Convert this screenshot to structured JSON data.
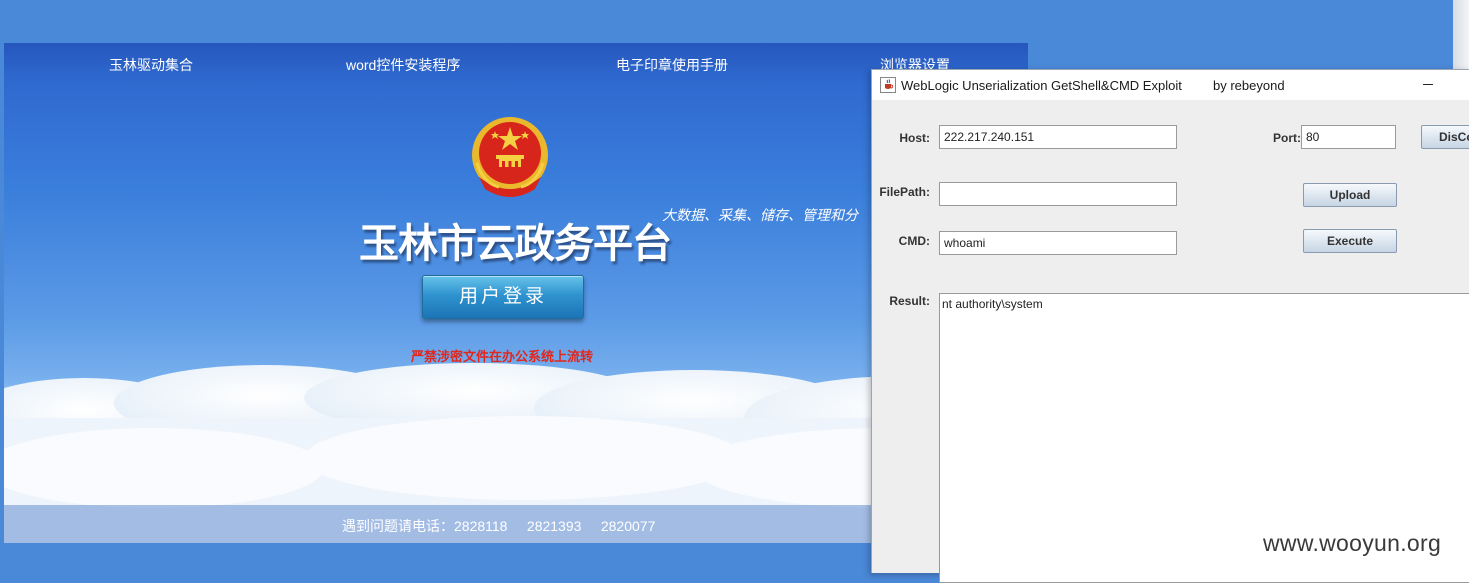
{
  "webpage": {
    "nav": [
      "玉林驱动集合",
      "word控件安装程序",
      "电子印章使用手册",
      "浏览器设置"
    ],
    "title": "玉林市云政务平台",
    "slogan": "大数据、采集、储存、管理和分",
    "login_button": "用户登录",
    "warning": "严禁涉密文件在办公系统上流转",
    "footer": "遇到问题请电话：2828118     2821393     2820077"
  },
  "exploit_window": {
    "title": "WebLogic Unserialization GetShell&CMD Exploit",
    "author": "by rebeyond",
    "host_label": "Host:",
    "host_value": "222.217.240.151",
    "port_label": "Port:",
    "port_value": "80",
    "disconnect_label": "DisCo",
    "filepath_label": "FilePath:",
    "filepath_value": "",
    "upload_label": "Upload",
    "cmd_label": "CMD:",
    "cmd_value": "whoami",
    "execute_label": "Execute",
    "result_label": "Result:",
    "result_value": "nt authority\\system"
  },
  "watermark": "www.wooyun.org",
  "colors": {
    "page_blue": "#4a88d8",
    "warning_red": "#e1261c",
    "login_button": "#2f93cf",
    "window_bg": "#eeeeee"
  },
  "icons": [
    "national-emblem-icon",
    "java-cup-icon",
    "minimize-icon"
  ]
}
